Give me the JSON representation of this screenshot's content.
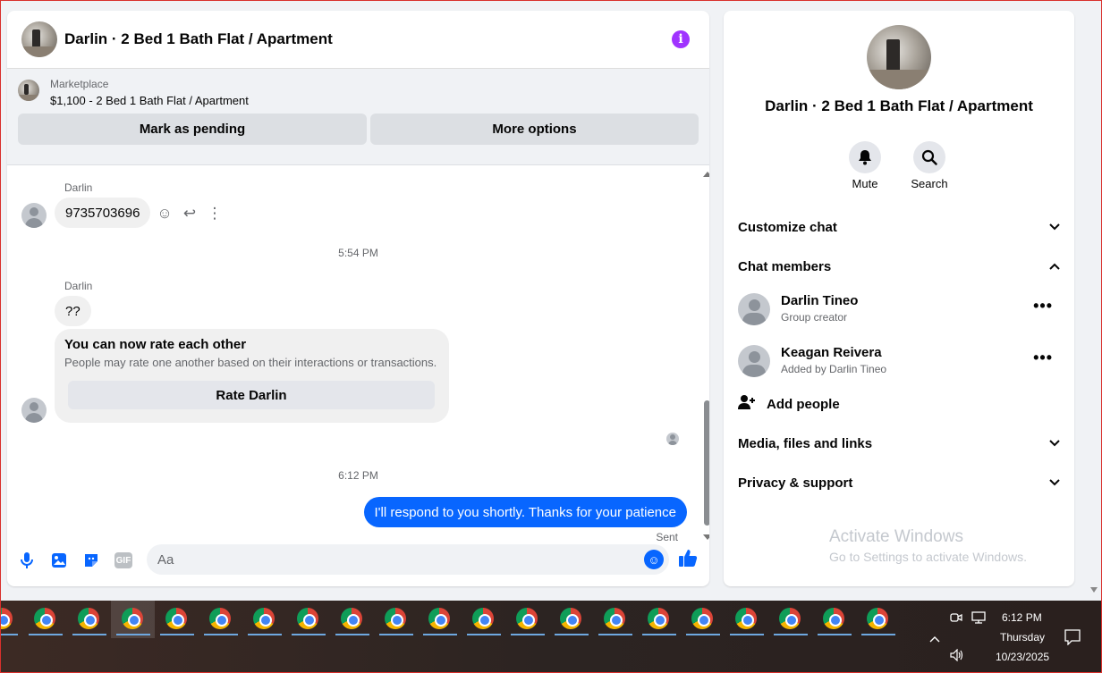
{
  "header": {
    "title": "Darlin · 2 Bed 1 Bath Flat / Apartment",
    "info_icon": "info-icon"
  },
  "marketplace": {
    "label": "Marketplace",
    "listing": "$1,100 - 2 Bed 1 Bath Flat / Apartment",
    "mark_pending": "Mark as pending",
    "more_options": "More options"
  },
  "messages": {
    "sender_1": "Darlin",
    "phone_message": "9735703696",
    "time_1": "5:54 PM",
    "sender_2": "Darlin",
    "question_message": "??",
    "rate_card": {
      "title": "You can now rate each other",
      "subtitle": "People may rate one another based on their interactions or transactions.",
      "button": "Rate Darlin"
    },
    "time_2": "6:12 PM",
    "outgoing_message": "I'll respond to you shortly. Thanks for your patience",
    "status": "Sent"
  },
  "composer": {
    "placeholder": "Aa",
    "gif_label": "GIF"
  },
  "info_panel": {
    "title": "Darlin · 2 Bed 1 Bath Flat / Apartment",
    "mute_label": "Mute",
    "search_label": "Search",
    "sections": {
      "customize": "Customize chat",
      "members": "Chat members",
      "media": "Media, files and links",
      "privacy": "Privacy & support"
    },
    "members_list": [
      {
        "name": "Darlin Tineo",
        "role": "Group creator"
      },
      {
        "name": "Keagan Reivera",
        "role": "Added by Darlin Tineo"
      }
    ],
    "add_people": "Add people",
    "watermark_title": "Activate Windows",
    "watermark_sub": "Go to Settings to activate Windows."
  },
  "taskbar": {
    "time": "6:12 PM",
    "day": "Thursday",
    "date": "10/23/2025"
  },
  "colors": {
    "accent": "#0866ff",
    "info": "#a033ff"
  }
}
